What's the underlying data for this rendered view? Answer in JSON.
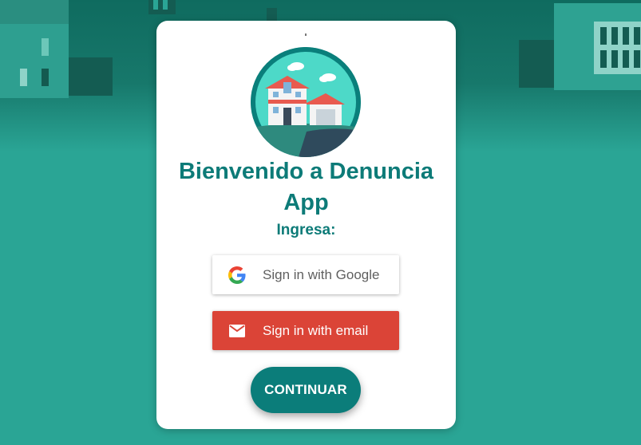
{
  "app": {
    "title": "Bienvenido a Denuncia App",
    "subtitle": "Ingresa:"
  },
  "auth": {
    "google_label": "Sign in with Google",
    "email_label": "Sign in with email",
    "continue_label": "CONTINUAR"
  },
  "icons": {
    "google": "google-g-icon",
    "email": "mail-icon",
    "logo": "house-illustration"
  },
  "colors": {
    "accent": "#0b7d7a",
    "background": "#2aa595",
    "email_button": "#db4437",
    "card": "#ffffff"
  }
}
